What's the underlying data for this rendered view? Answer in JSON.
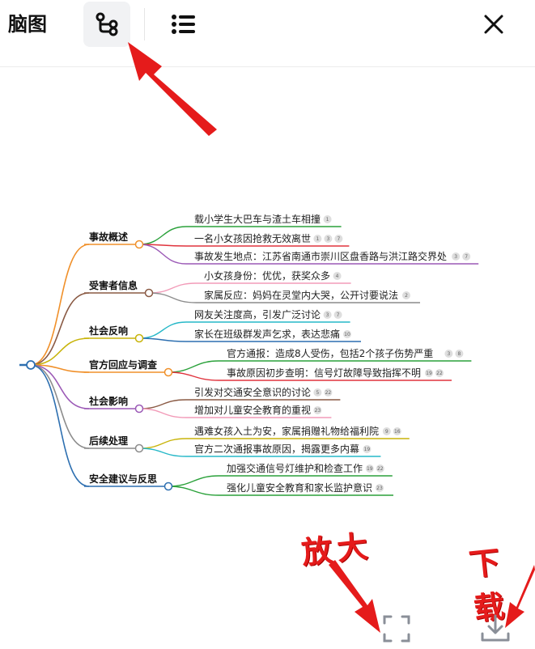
{
  "header": {
    "title": "脑图",
    "tabs": [
      {
        "icon": "mindmap-icon",
        "active": true
      },
      {
        "icon": "list-icon",
        "active": false
      }
    ],
    "close_icon": "close-icon"
  },
  "mindmap": {
    "branches": [
      {
        "label": "事故概述",
        "color": "#f0902a",
        "children": [
          {
            "text": "载小学生大巴车与渣土车相撞",
            "refs": [
              "1"
            ],
            "color": "#2aa13a"
          },
          {
            "text": "一名小女孩因抢救无效离世",
            "refs": [
              "1",
              "3",
              "7"
            ],
            "color": "#e0333d"
          },
          {
            "text": "事故发生地点：江苏省南通市崇川区盘香路与洪江路交界处",
            "refs": [
              "3",
              "7"
            ],
            "color": "#9b59b6"
          }
        ]
      },
      {
        "label": "受害者信息",
        "color": "#8a5a44",
        "children": [
          {
            "text": "小女孩身份：优优，获奖众多",
            "refs": [
              "4"
            ],
            "color": "#f29bb8"
          },
          {
            "text": "家属反应：妈妈在灵堂内大哭，公开讨要说法",
            "refs": [
              "2"
            ],
            "color": "#8c8c8c"
          }
        ]
      },
      {
        "label": "社会反响",
        "color": "#c8b40a",
        "children": [
          {
            "text": "网友关注度高，引发广泛讨论",
            "refs": [
              "3",
              "7"
            ],
            "color": "#27b8c8"
          },
          {
            "text": "家长在班级群发声乞求，表达悲痛",
            "refs": [
              "10"
            ],
            "color": "#2d6fb0"
          }
        ]
      },
      {
        "label": "官方回应与调查",
        "color": "#f0902a",
        "children": [
          {
            "text": "官方通报：造成8人受伤，包括2个孩子伤势严重",
            "refs": [
              "3",
              "8"
            ],
            "color": "#2aa13a"
          },
          {
            "text": "事故原因初步查明：信号灯故障导致指挥不明",
            "refs": [
              "19",
              "22"
            ],
            "color": "#e0333d"
          }
        ]
      },
      {
        "label": "社会影响",
        "color": "#9b59b6",
        "children": [
          {
            "text": "引发对交通安全意识的讨论",
            "refs": [
              "5",
              "22"
            ],
            "color": "#8a5a44"
          },
          {
            "text": "增加对儿童安全教育的重视",
            "refs": [
              "23"
            ],
            "color": "#f29bb8"
          }
        ]
      },
      {
        "label": "后续处理",
        "color": "#8c8c8c",
        "children": [
          {
            "text": "遇难女孩入土为安，家属捐赠礼物给福利院",
            "refs": [
              "9",
              "16"
            ],
            "color": "#c8b40a"
          },
          {
            "text": "官方二次通报事故原因，揭露更多内幕",
            "refs": [
              "19"
            ],
            "color": "#27b8c8"
          }
        ]
      },
      {
        "label": "安全建议与反思",
        "color": "#2d6fb0",
        "children": [
          {
            "text": "加强交通信号灯维护和检查工作",
            "refs": [
              "19",
              "22"
            ],
            "color": "#2aa13a"
          },
          {
            "text": "强化儿童安全教育和家长监护意识",
            "refs": [
              "23"
            ],
            "color": "#2aa13a"
          }
        ]
      }
    ]
  },
  "annotations": {
    "zoom": "放大",
    "download": "下载"
  },
  "bottom": {
    "fullscreen_icon": "fullscreen-icon",
    "download_icon": "download-icon"
  },
  "colors": {
    "arrow": "#e51b1b",
    "root": "#2d6fb0"
  }
}
